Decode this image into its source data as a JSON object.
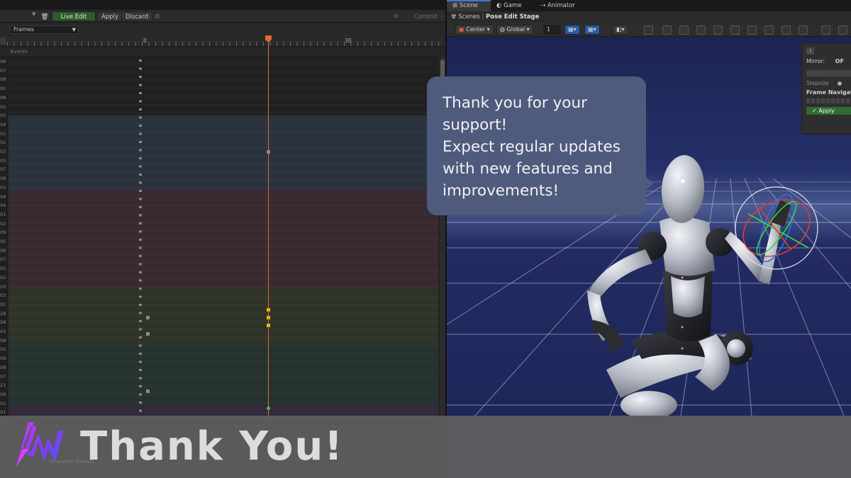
{
  "left": {
    "toolbar": {
      "live_edit": "Live Edit",
      "apply": "Apply",
      "discard": "Discard",
      "commit": "Commit"
    },
    "frames_dropdown": "Frames",
    "ruler_labels": [
      "0",
      "30"
    ],
    "events_label": "Events",
    "row_numbers": [
      "06",
      "07",
      "08",
      "00",
      "08",
      "02",
      "05",
      "04",
      "02",
      "02",
      "02",
      "03",
      "07",
      "08",
      "03",
      "04",
      "04",
      "01",
      "02",
      "09",
      "05",
      "06",
      "07",
      "02",
      "02",
      "20",
      "03",
      "02",
      "28",
      "28",
      "43",
      "08",
      "02",
      "09",
      "08",
      "07",
      "21",
      "08",
      "02",
      "01",
      "02"
    ],
    "colors": {
      "playhead": "#e06a32",
      "key_active": "#f2c814",
      "key_green": "#34c759"
    }
  },
  "right": {
    "tabs": [
      "Scene",
      "Game",
      "Animator"
    ],
    "breadcrumb": {
      "scenes": "Scenes",
      "stage": "Pose Edit Stage"
    },
    "toolbar": {
      "pivot": "Center",
      "space": "Global",
      "snap_value": "1"
    },
    "inspector": {
      "info": "i",
      "mirror_label": "Mirror:",
      "mirror_value": "OF",
      "stepsize_label": "Stepsize",
      "frame_nav_label": "Frame Navigat",
      "apply_label": "✓ Apply"
    }
  },
  "bubble": {
    "text": "Thank you for your\nsupport!\nExpect regular updates\nwith new features and\nimprovements!"
  },
  "banner": {
    "title": "Thank You!",
    "under_text": "Character  Default"
  }
}
